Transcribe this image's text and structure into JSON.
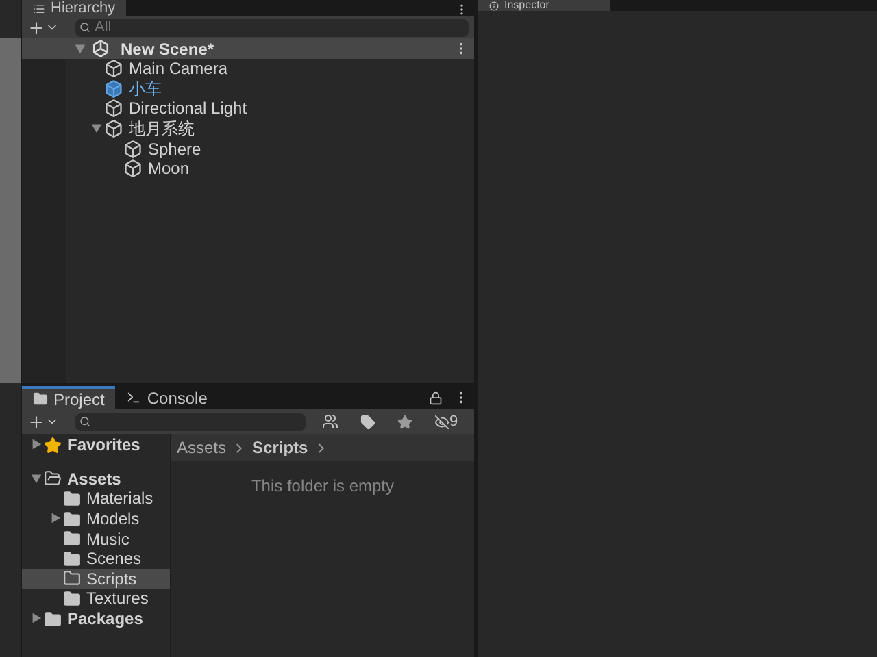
{
  "hierarchy": {
    "title": "Hierarchy",
    "search": {
      "placeholder": "All"
    },
    "scene": {
      "name": "New Scene*",
      "expanded": true,
      "children": [
        {
          "name": "Main Camera",
          "kind": "object"
        },
        {
          "name": "小车",
          "kind": "prefab"
        },
        {
          "name": "Directional Light",
          "kind": "object"
        },
        {
          "name": "地月系统",
          "kind": "object",
          "expanded": true,
          "children": [
            {
              "name": "Sphere",
              "kind": "object"
            },
            {
              "name": "Moon",
              "kind": "object"
            }
          ]
        }
      ]
    }
  },
  "inspector": {
    "title": "Inspector"
  },
  "project": {
    "tabs": [
      {
        "label": "Project",
        "kind": "folder",
        "selected": true
      },
      {
        "label": "Console",
        "kind": "console",
        "selected": false
      }
    ],
    "hidden_count": "9",
    "tree": [
      {
        "name": "Favorites",
        "kind": "favorites",
        "expanded": false
      },
      {
        "name": "Assets",
        "kind": "folder",
        "expanded": true,
        "children": [
          {
            "name": "Materials",
            "kind": "folder",
            "selected": false
          },
          {
            "name": "Models",
            "kind": "folder",
            "expanded": false,
            "selected": false
          },
          {
            "name": "Music",
            "kind": "folder",
            "selected": false
          },
          {
            "name": "Scenes",
            "kind": "folder",
            "selected": false
          },
          {
            "name": "Scripts",
            "kind": "folder",
            "selected": true
          },
          {
            "name": "Textures",
            "kind": "folder",
            "selected": false
          }
        ]
      },
      {
        "name": "Packages",
        "kind": "folder",
        "expanded": false
      }
    ],
    "breadcrumb": [
      "Assets",
      "Scripts"
    ],
    "empty_message": "This folder is empty"
  }
}
